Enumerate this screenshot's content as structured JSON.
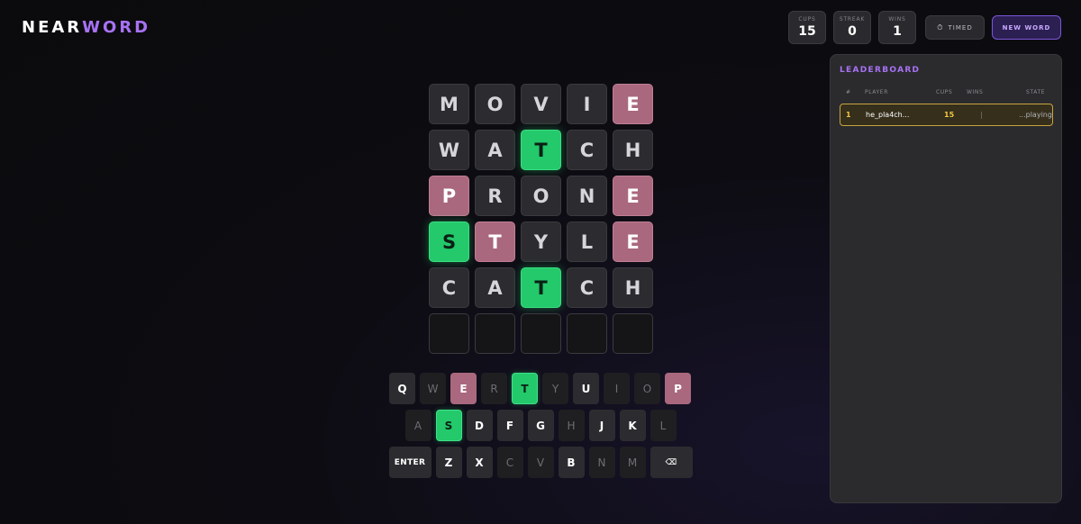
{
  "logo": {
    "part1": "NEAR",
    "part2": "WORD"
  },
  "stats": [
    {
      "label": "CUPS",
      "value": "15"
    },
    {
      "label": "STREAK",
      "value": "0"
    },
    {
      "label": "WINS",
      "value": "1"
    }
  ],
  "buttons": {
    "timed_icon": "stopwatch-icon",
    "timed_label": "TIMED",
    "new_word_label": "NEW WORD"
  },
  "colors": {
    "accent": "#a872f5",
    "correct": "#23c96a",
    "present": "#a9687e",
    "gold": "#f4c542"
  },
  "board": {
    "rows": [
      [
        {
          "l": "M",
          "s": "absent"
        },
        {
          "l": "O",
          "s": "absent"
        },
        {
          "l": "V",
          "s": "absent"
        },
        {
          "l": "I",
          "s": "absent"
        },
        {
          "l": "E",
          "s": "present"
        }
      ],
      [
        {
          "l": "W",
          "s": "absent"
        },
        {
          "l": "A",
          "s": "absent"
        },
        {
          "l": "T",
          "s": "correct"
        },
        {
          "l": "C",
          "s": "absent"
        },
        {
          "l": "H",
          "s": "absent"
        }
      ],
      [
        {
          "l": "P",
          "s": "present"
        },
        {
          "l": "R",
          "s": "absent"
        },
        {
          "l": "O",
          "s": "absent"
        },
        {
          "l": "N",
          "s": "absent"
        },
        {
          "l": "E",
          "s": "present"
        }
      ],
      [
        {
          "l": "S",
          "s": "correct"
        },
        {
          "l": "T",
          "s": "present"
        },
        {
          "l": "Y",
          "s": "absent"
        },
        {
          "l": "L",
          "s": "absent"
        },
        {
          "l": "E",
          "s": "present"
        }
      ],
      [
        {
          "l": "C",
          "s": "absent"
        },
        {
          "l": "A",
          "s": "absent"
        },
        {
          "l": "T",
          "s": "correct"
        },
        {
          "l": "C",
          "s": "absent"
        },
        {
          "l": "H",
          "s": "absent"
        }
      ],
      [
        {
          "l": "",
          "s": "empty"
        },
        {
          "l": "",
          "s": "empty"
        },
        {
          "l": "",
          "s": "empty"
        },
        {
          "l": "",
          "s": "empty"
        },
        {
          "l": "",
          "s": "empty"
        }
      ]
    ]
  },
  "keyboard": {
    "rows": [
      [
        {
          "k": "Q",
          "s": "unused"
        },
        {
          "k": "W",
          "s": "used"
        },
        {
          "k": "E",
          "s": "present"
        },
        {
          "k": "R",
          "s": "used"
        },
        {
          "k": "T",
          "s": "correct"
        },
        {
          "k": "Y",
          "s": "used"
        },
        {
          "k": "U",
          "s": "unused"
        },
        {
          "k": "I",
          "s": "used"
        },
        {
          "k": "O",
          "s": "used"
        },
        {
          "k": "P",
          "s": "present"
        }
      ],
      [
        {
          "k": "A",
          "s": "used"
        },
        {
          "k": "S",
          "s": "correct"
        },
        {
          "k": "D",
          "s": "unused"
        },
        {
          "k": "F",
          "s": "unused"
        },
        {
          "k": "G",
          "s": "unused"
        },
        {
          "k": "H",
          "s": "used"
        },
        {
          "k": "J",
          "s": "unused"
        },
        {
          "k": "K",
          "s": "unused"
        },
        {
          "k": "L",
          "s": "used"
        }
      ],
      [
        {
          "k": "ENTER",
          "s": "unused",
          "wide": true
        },
        {
          "k": "Z",
          "s": "unused"
        },
        {
          "k": "X",
          "s": "unused"
        },
        {
          "k": "C",
          "s": "used"
        },
        {
          "k": "V",
          "s": "used"
        },
        {
          "k": "B",
          "s": "unused"
        },
        {
          "k": "N",
          "s": "used"
        },
        {
          "k": "M",
          "s": "used"
        },
        {
          "k": "⌫",
          "s": "unused",
          "wide": true
        }
      ]
    ]
  },
  "leaderboard": {
    "title": "LEADERBOARD",
    "columns": {
      "rank": "#",
      "player": "PLAYER",
      "cups": "CUPS",
      "wins": "WINS",
      "state": "STATE"
    },
    "rows": [
      {
        "rank": "1",
        "player": "he_pla4ch...",
        "cups": "15",
        "wins": "|",
        "state": "...playing"
      }
    ]
  }
}
